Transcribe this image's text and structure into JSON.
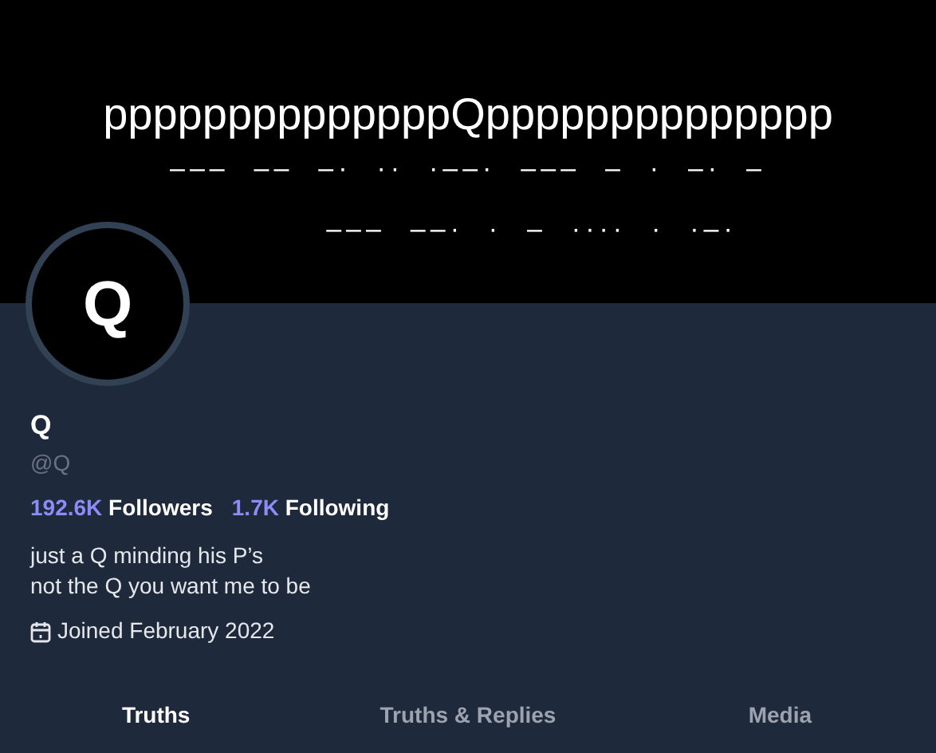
{
  "banner": {
    "title": "ppppppppppppppQpppppppppppppp",
    "lines": [
      "–––  ––  –·  ··  ·––·  –––  –  ·  –·  –",
      "–––  ––·  ·  –  ····  ·  ·–·"
    ]
  },
  "profile": {
    "avatar_letter": "Q",
    "name": "Q",
    "handle": "@Q",
    "stats": [
      {
        "count": "192.6K",
        "label": "Followers"
      },
      {
        "count": "1.7K",
        "label": "Following"
      }
    ],
    "bio": [
      "just a Q minding his P’s",
      "not the Q you want me to be"
    ],
    "joined": "Joined February 2022"
  },
  "tabs": [
    {
      "label": "Truths",
      "selected": true
    },
    {
      "label": "Truths & Replies",
      "selected": false
    },
    {
      "label": "Media",
      "selected": false
    }
  ]
}
